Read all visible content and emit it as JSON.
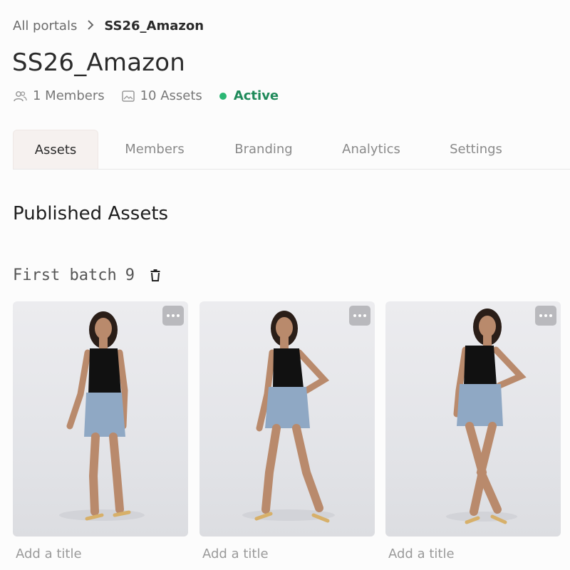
{
  "breadcrumb": {
    "root": "All portals",
    "separator": ">",
    "current": "SS26_Amazon"
  },
  "page": {
    "title": "SS26_Amazon"
  },
  "meta": {
    "members": "1 Members",
    "assets": "10 Assets",
    "status": "Active"
  },
  "tabs": [
    "Assets",
    "Members",
    "Branding",
    "Analytics",
    "Settings"
  ],
  "active_tab": "Assets",
  "section": {
    "title": "Published Assets"
  },
  "batch": {
    "label": "First batch",
    "count": "9"
  },
  "assets": [
    {
      "title_placeholder": "Add a title",
      "image": "model-photo-1"
    },
    {
      "title_placeholder": "Add a title",
      "image": "model-photo-2"
    },
    {
      "title_placeholder": "Add a title",
      "image": "model-photo-3"
    }
  ],
  "colors": {
    "status": "#2bb673",
    "active_tab_bg": "#f6f1ef"
  }
}
